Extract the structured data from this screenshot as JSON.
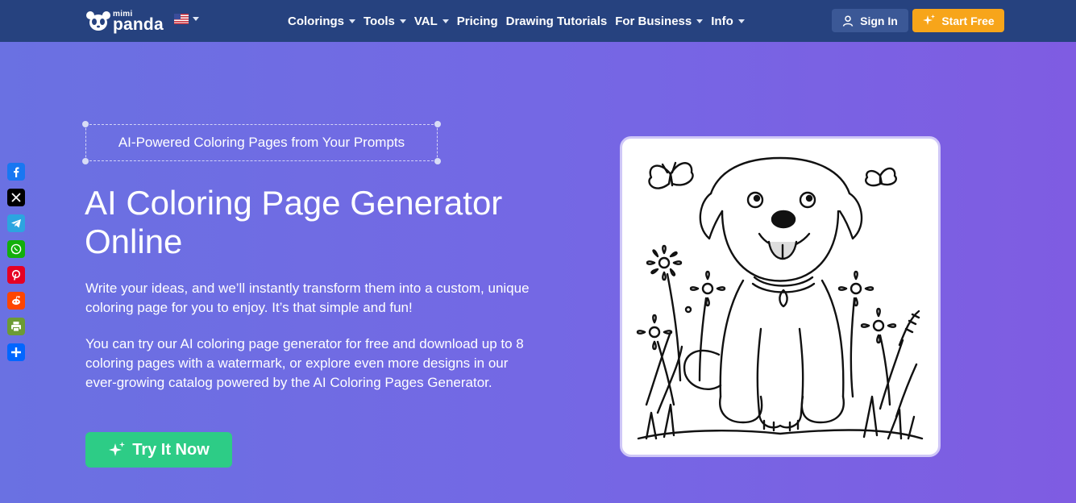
{
  "header": {
    "logo": {
      "top": "mimi",
      "bottom": "panda"
    },
    "language": {
      "icon": "us-flag-icon"
    },
    "nav": [
      {
        "label": "Colorings",
        "has_dropdown": true
      },
      {
        "label": "Tools",
        "has_dropdown": true
      },
      {
        "label": "VAL",
        "has_dropdown": true
      },
      {
        "label": "Pricing",
        "has_dropdown": false
      },
      {
        "label": "Drawing Tutorials",
        "has_dropdown": false
      },
      {
        "label": "For Business",
        "has_dropdown": true
      },
      {
        "label": "Info",
        "has_dropdown": true
      }
    ],
    "sign_in": "Sign In",
    "start_free": "Start Free"
  },
  "share": [
    {
      "icon": "facebook-icon",
      "color": "#1877f2"
    },
    {
      "icon": "x-icon",
      "color": "#000000"
    },
    {
      "icon": "telegram-icon",
      "color": "#2ca5e0"
    },
    {
      "icon": "whatsapp-icon",
      "color": "#12af0a"
    },
    {
      "icon": "pinterest-icon",
      "color": "#e60023"
    },
    {
      "icon": "reddit-icon",
      "color": "#ff4500"
    },
    {
      "icon": "print-icon",
      "color": "#6c9b35"
    },
    {
      "icon": "share-icon",
      "color": "#0166ff"
    }
  ],
  "hero": {
    "tagline": "AI-Powered Coloring Pages from Your Prompts",
    "title": "AI Coloring Page Generator Online",
    "paragraph1": "Write your ideas, and we’ll instantly transform them into a custom, unique coloring page for you to enjoy. It’s that simple and fun!",
    "paragraph2": "You can try our AI coloring page generator for free and download up to 8 coloring pages with a watermark, or explore even more designs in our ever-growing catalog powered by the AI Coloring Pages Generator.",
    "cta": "Try It Now"
  },
  "colors": {
    "header_bg": "#26427f",
    "start_free_bg": "#f7a51a",
    "sign_in_bg": "#3b5896",
    "cta_bg": "#2dcc86",
    "gradient_start": "#6a71e2",
    "gradient_end": "#7f5ce2"
  }
}
